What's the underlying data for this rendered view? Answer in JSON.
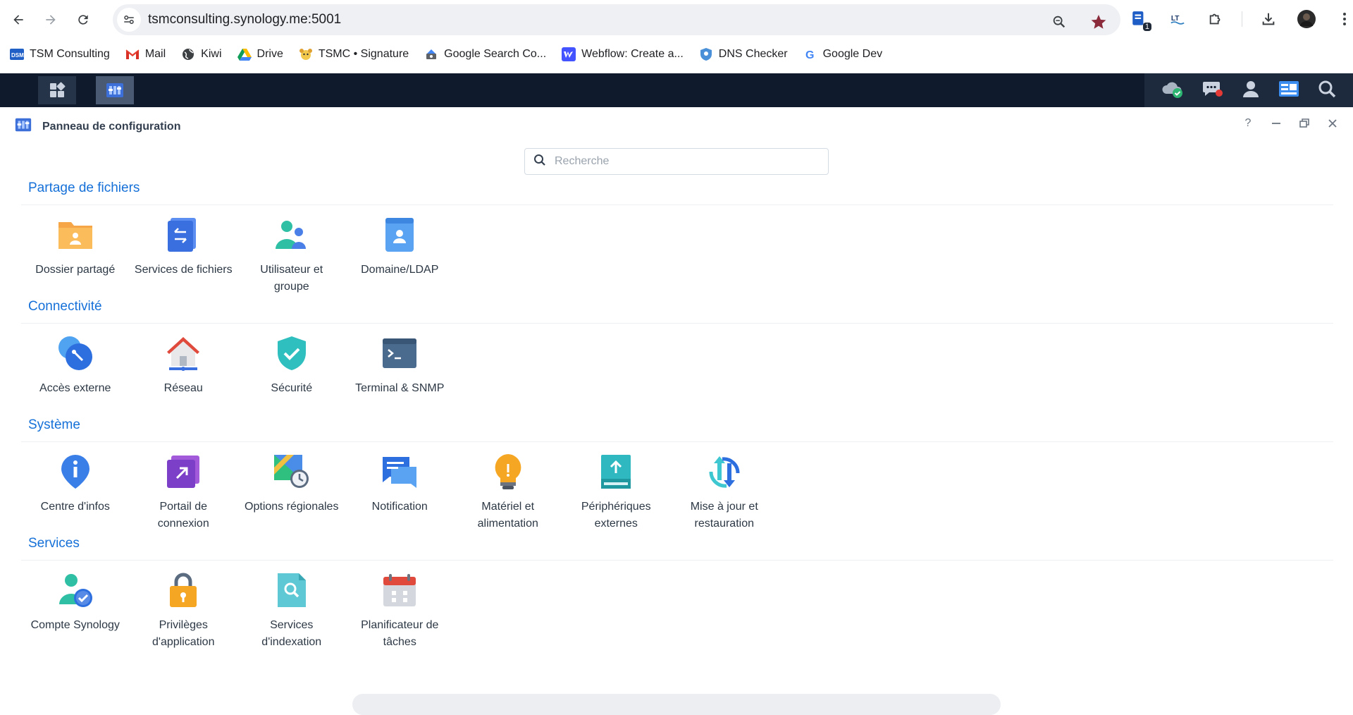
{
  "browser": {
    "url": "tsmconsulting.synology.me:5001",
    "extension_badge": "1",
    "bookmarks": [
      {
        "label": "TSM Consulting",
        "icon": "dsm-icon"
      },
      {
        "label": "Mail",
        "icon": "gmail-icon"
      },
      {
        "label": "Kiwi",
        "icon": "globe-icon"
      },
      {
        "label": "Drive",
        "icon": "drive-icon"
      },
      {
        "label": "TSMC • Signature",
        "icon": "signature-icon"
      },
      {
        "label": "Google Search Co...",
        "icon": "search-console-icon"
      },
      {
        "label": "Webflow: Create a...",
        "icon": "webflow-icon"
      },
      {
        "label": "DNS Checker",
        "icon": "dns-icon"
      },
      {
        "label": "Google Dev",
        "icon": "google-icon"
      }
    ]
  },
  "window": {
    "title": "Panneau de configuration",
    "help": "?",
    "search_placeholder": "Recherche"
  },
  "sections": [
    {
      "title": "Partage de fichiers",
      "items": [
        {
          "label": "Dossier partagé",
          "icon": "shared-folder-icon"
        },
        {
          "label": "Services de fichiers",
          "icon": "file-services-icon"
        },
        {
          "label": "Utilisateur et groupe",
          "icon": "user-group-icon"
        },
        {
          "label": "Domaine/LDAP",
          "icon": "domain-ldap-icon"
        }
      ]
    },
    {
      "title": "Connectivité",
      "items": [
        {
          "label": "Accès externe",
          "icon": "external-access-icon"
        },
        {
          "label": "Réseau",
          "icon": "network-icon"
        },
        {
          "label": "Sécurité",
          "icon": "security-icon"
        },
        {
          "label": "Terminal & SNMP",
          "icon": "terminal-icon"
        }
      ]
    },
    {
      "title": "Système",
      "items": [
        {
          "label": "Centre d'infos",
          "icon": "info-center-icon"
        },
        {
          "label": "Portail de connexion",
          "icon": "login-portal-icon"
        },
        {
          "label": "Options régionales",
          "icon": "regional-options-icon"
        },
        {
          "label": "Notification",
          "icon": "notification-icon"
        },
        {
          "label": "Matériel et alimentation",
          "icon": "hardware-power-icon"
        },
        {
          "label": "Périphériques externes",
          "icon": "external-devices-icon"
        },
        {
          "label": "Mise à jour et restauration",
          "icon": "update-restore-icon"
        }
      ]
    },
    {
      "title": "Services",
      "items": [
        {
          "label": "Compte Synology",
          "icon": "synology-account-icon"
        },
        {
          "label": "Privilèges d'application",
          "icon": "app-privileges-icon"
        },
        {
          "label": "Services d'indexation",
          "icon": "indexing-icon"
        },
        {
          "label": "Planificateur de tâches",
          "icon": "task-scheduler-icon"
        }
      ]
    }
  ],
  "colors": {
    "section_title": "#1570d8",
    "taskbar": "#0f1a2c"
  }
}
